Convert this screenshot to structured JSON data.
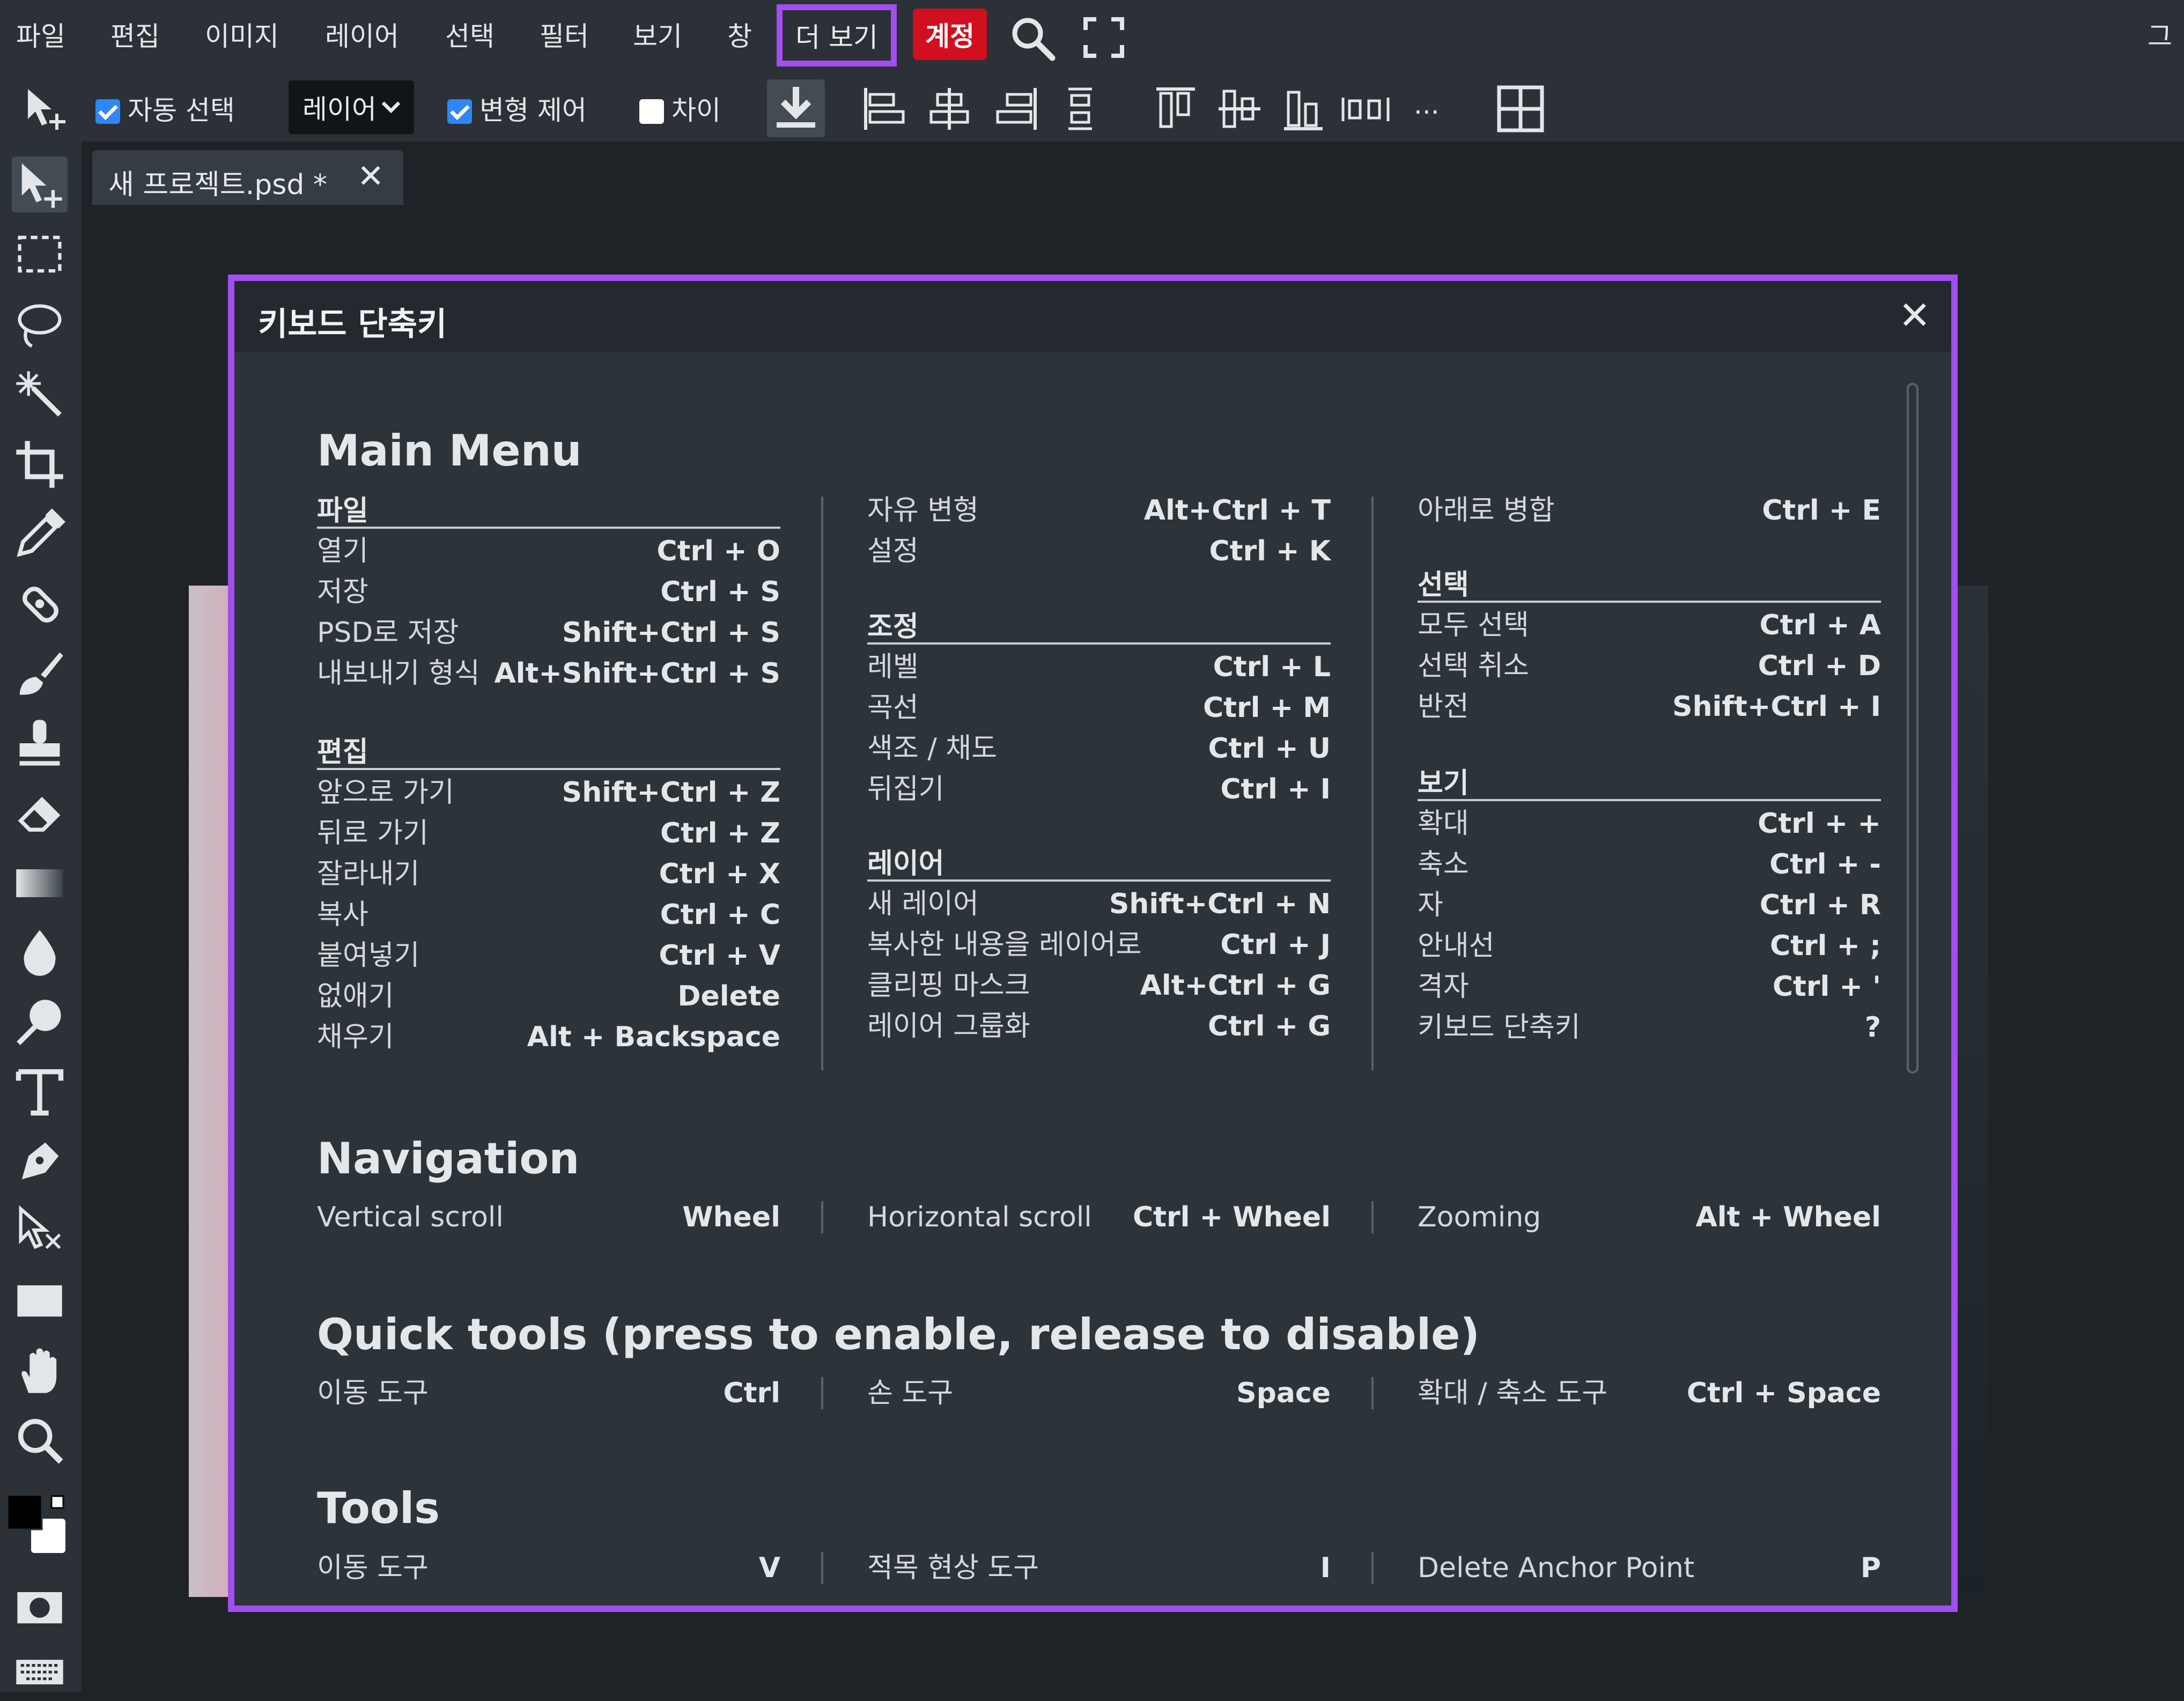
{
  "menubar": {
    "items": [
      "파일",
      "편집",
      "이미지",
      "레이어",
      "선택",
      "필터",
      "보기",
      "창"
    ],
    "more_label": "더 보기",
    "account_label": "계정",
    "right_label": "그"
  },
  "toolbar": {
    "auto_select_label": "자동 선택",
    "auto_select_checked": true,
    "layer_select_value": "레이어",
    "transform_label": "변형 제어",
    "transform_checked": true,
    "diff_label": "차이",
    "diff_checked": false,
    "ellipsis": "..."
  },
  "tab": {
    "title": "새 프로젝트.psd *",
    "close": "✕"
  },
  "dialog": {
    "title": "키보드 단축키",
    "close": "✕",
    "main_menu": {
      "title": "Main Menu",
      "col1": {
        "groups": [
          {
            "title": "파일",
            "rows": [
              [
                "열기",
                "Ctrl + O"
              ],
              [
                "저장",
                "Ctrl + S"
              ],
              [
                "PSD로 저장",
                "Shift+Ctrl + S"
              ],
              [
                "내보내기 형식",
                "Alt+Shift+Ctrl + S"
              ]
            ]
          },
          {
            "title": "편집",
            "rows": [
              [
                "앞으로 가기",
                "Shift+Ctrl + Z"
              ],
              [
                "뒤로 가기",
                "Ctrl + Z"
              ],
              [
                "잘라내기",
                "Ctrl + X"
              ],
              [
                "복사",
                "Ctrl + C"
              ],
              [
                "붙여넣기",
                "Ctrl + V"
              ],
              [
                "없애기",
                "Delete"
              ],
              [
                "채우기",
                "Alt + Backspace"
              ]
            ]
          }
        ]
      },
      "col2": {
        "top_rows": [
          [
            "자유 변형",
            "Alt+Ctrl + T"
          ],
          [
            "설정",
            "Ctrl + K"
          ]
        ],
        "groups": [
          {
            "title": "조정",
            "rows": [
              [
                "레벨",
                "Ctrl + L"
              ],
              [
                "곡선",
                "Ctrl + M"
              ],
              [
                "색조 / 채도",
                "Ctrl + U"
              ],
              [
                "뒤집기",
                "Ctrl + I"
              ]
            ]
          },
          {
            "title": "레이어",
            "rows": [
              [
                "새 레이어",
                "Shift+Ctrl + N"
              ],
              [
                "복사한 내용을 레이어로",
                "Ctrl + J"
              ],
              [
                "클리핑 마스크",
                "Alt+Ctrl + G"
              ],
              [
                "레이어 그룹화",
                "Ctrl + G"
              ]
            ]
          }
        ]
      },
      "col3": {
        "top_rows": [
          [
            "아래로 병합",
            "Ctrl + E"
          ]
        ],
        "groups": [
          {
            "title": "선택",
            "rows": [
              [
                "모두 선택",
                "Ctrl + A"
              ],
              [
                "선택 취소",
                "Ctrl + D"
              ],
              [
                "반전",
                "Shift+Ctrl + I"
              ]
            ]
          },
          {
            "title": "보기",
            "rows": [
              [
                "확대",
                "Ctrl + +"
              ],
              [
                "축소",
                "Ctrl + -"
              ],
              [
                "자",
                "Ctrl + R"
              ],
              [
                "안내선",
                "Ctrl + ;"
              ],
              [
                "격자",
                "Ctrl + '"
              ],
              [
                "키보드 단축키",
                "?"
              ]
            ]
          }
        ]
      }
    },
    "navigation": {
      "title": "Navigation",
      "rows": [
        [
          "Vertical scroll",
          "Wheel"
        ],
        [
          "Horizontal scroll",
          "Ctrl + Wheel"
        ],
        [
          "Zooming",
          "Alt + Wheel"
        ]
      ]
    },
    "quick_tools": {
      "title": "Quick tools (press to enable, release to disable)",
      "rows": [
        [
          "이동 도구",
          "Ctrl"
        ],
        [
          "손 도구",
          "Space"
        ],
        [
          "확대 / 축소 도구",
          "Ctrl + Space"
        ]
      ]
    },
    "tools": {
      "title": "Tools",
      "rows": [
        [
          "이동 도구",
          "V"
        ],
        [
          "적목 현상 도구",
          "I"
        ],
        [
          "Delete Anchor Point",
          "P"
        ]
      ]
    }
  },
  "colors": {
    "accent_outline": "#a34ef0",
    "account_bg": "#d20f1f",
    "checkbox_blue": "#2f86f6",
    "panel_bg": "#2b3137"
  }
}
